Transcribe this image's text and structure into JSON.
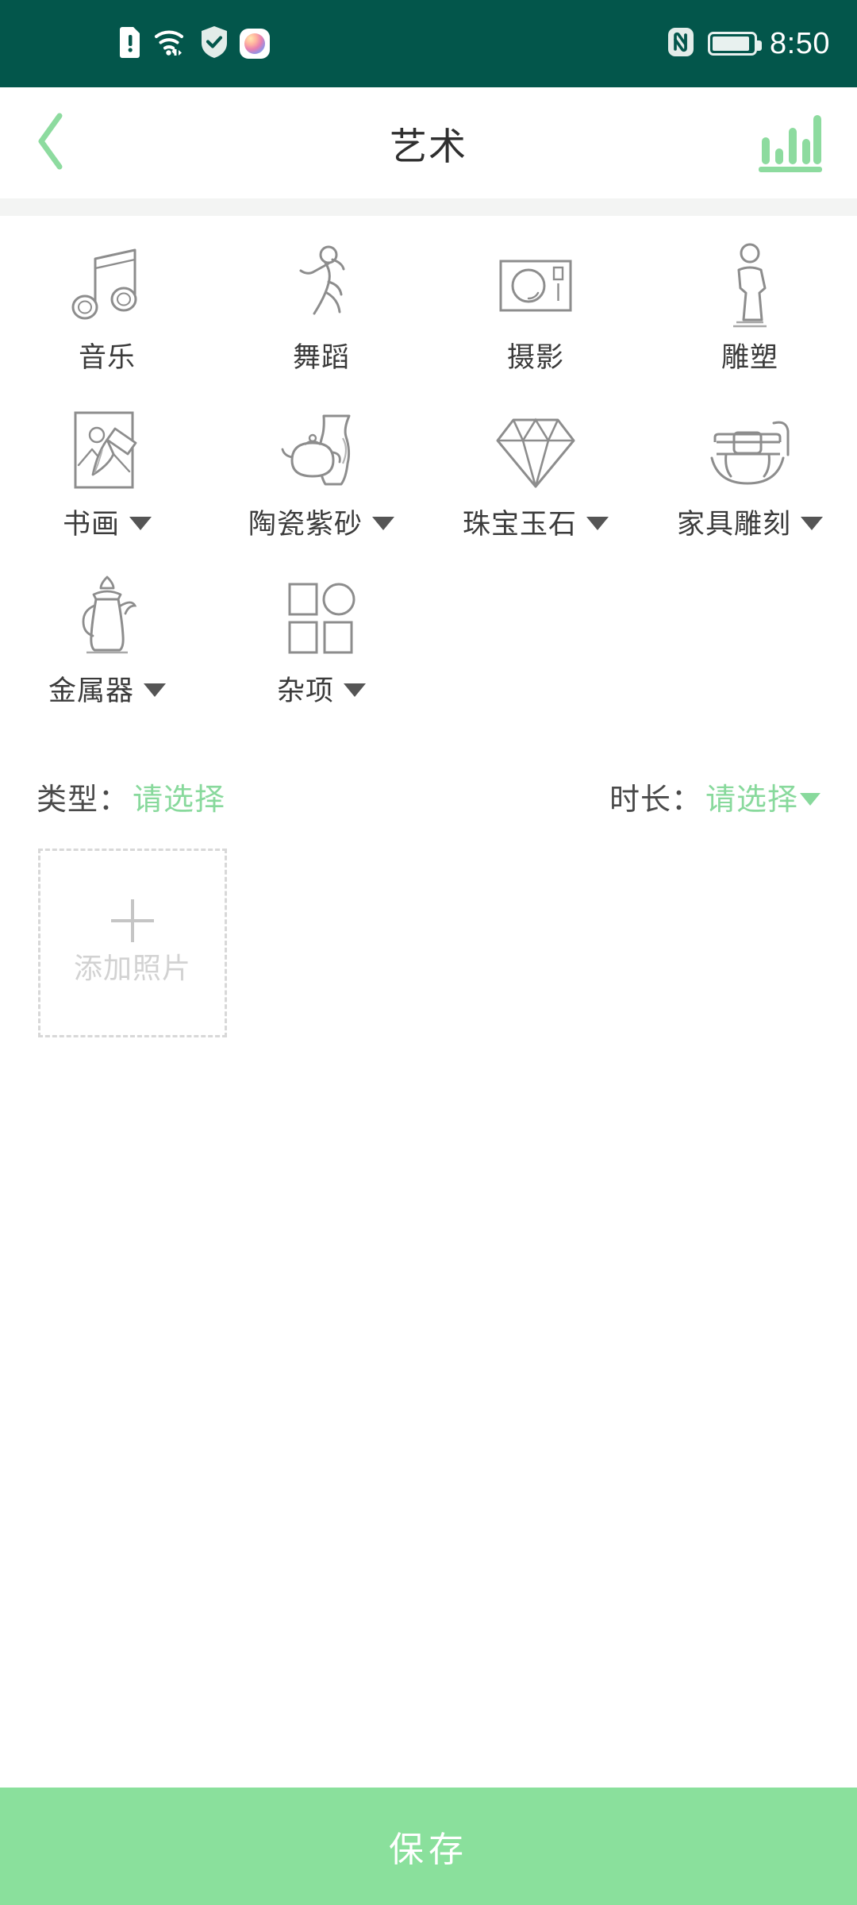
{
  "status_bar": {
    "background_color": "#03564b",
    "left_icons": [
      "sim-alert-icon",
      "wifi-icon",
      "shield-check-icon",
      "app-orb-icon"
    ],
    "right_icons": [
      "nfc-icon",
      "battery-icon"
    ],
    "time": "8:50"
  },
  "header": {
    "back_icon": "chevron-left-icon",
    "title": "艺术",
    "action_icon": "bar-chart-icon",
    "accent_color": "#88d99c",
    "title_color": "#2f2f2f"
  },
  "categories": [
    {
      "label": "音乐",
      "icon": "music-note-icon",
      "has_dropdown": false
    },
    {
      "label": "舞蹈",
      "icon": "dancer-icon",
      "has_dropdown": false
    },
    {
      "label": "摄影",
      "icon": "camera-icon",
      "has_dropdown": false
    },
    {
      "label": "雕塑",
      "icon": "statue-icon",
      "has_dropdown": false
    },
    {
      "label": "书画",
      "icon": "painting-brush-icon",
      "has_dropdown": true
    },
    {
      "label": "陶瓷紫砂",
      "icon": "teapot-vase-icon",
      "has_dropdown": true
    },
    {
      "label": "珠宝玉石",
      "icon": "diamond-icon",
      "has_dropdown": true
    },
    {
      "label": "家具雕刻",
      "icon": "rocking-chair-icon",
      "has_dropdown": true
    },
    {
      "label": "金属器",
      "icon": "metal-pot-icon",
      "has_dropdown": true
    },
    {
      "label": "杂项",
      "icon": "grid-shapes-icon",
      "has_dropdown": true
    }
  ],
  "selectors": {
    "type": {
      "label": "类型：",
      "value": "请选择",
      "has_caret": false
    },
    "duration": {
      "label": "时长：",
      "value": "请选择",
      "has_caret": true
    }
  },
  "upload": {
    "plus_icon": "plus-icon",
    "text": "添加照片"
  },
  "footer": {
    "save_label": "保存",
    "save_color": "#8ae09c"
  }
}
